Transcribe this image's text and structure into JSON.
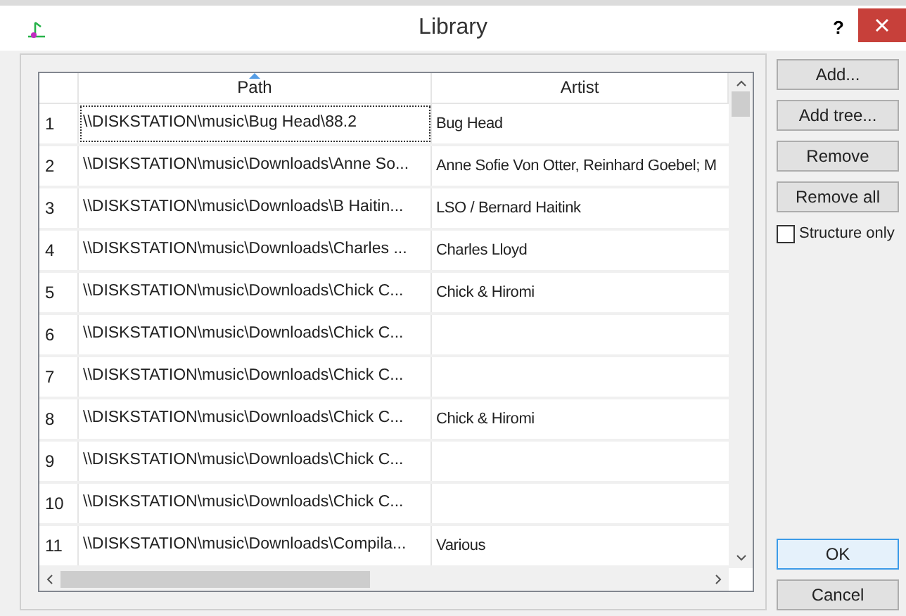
{
  "window": {
    "title": "Library",
    "help": "?"
  },
  "table": {
    "columns": [
      {
        "label": "Path",
        "sorted": true
      },
      {
        "label": "Artist",
        "sorted": false
      }
    ],
    "rows": [
      {
        "number": "1",
        "path": "\\\\DISKSTATION\\music\\Bug Head\\88.2",
        "artist": "Bug Head",
        "selected": true
      },
      {
        "number": "2",
        "path": "\\\\DISKSTATION\\music\\Downloads\\Anne So...",
        "artist": "Anne Sofie Von Otter, Reinhard Goebel; M",
        "selected": false
      },
      {
        "number": "3",
        "path": "\\\\DISKSTATION\\music\\Downloads\\B Haitin...",
        "artist": "LSO / Bernard Haitink",
        "selected": false
      },
      {
        "number": "4",
        "path": "\\\\DISKSTATION\\music\\Downloads\\Charles ...",
        "artist": "Charles Lloyd",
        "selected": false
      },
      {
        "number": "5",
        "path": "\\\\DISKSTATION\\music\\Downloads\\Chick C...",
        "artist": "Chick & Hiromi",
        "selected": false
      },
      {
        "number": "6",
        "path": "\\\\DISKSTATION\\music\\Downloads\\Chick C...",
        "selected": false
      },
      {
        "number": "7",
        "path": "\\\\DISKSTATION\\music\\Downloads\\Chick C...",
        "selected": false
      },
      {
        "number": "8",
        "path": "\\\\DISKSTATION\\music\\Downloads\\Chick C...",
        "artist": "Chick & Hiromi",
        "selected": false
      },
      {
        "number": "9",
        "path": "\\\\DISKSTATION\\music\\Downloads\\Chick C...",
        "selected": false
      },
      {
        "number": "10",
        "path": "\\\\DISKSTATION\\music\\Downloads\\Chick C...",
        "selected": false
      },
      {
        "number": "11",
        "path": "\\\\DISKSTATION\\music\\Downloads\\Compila...",
        "artist": "Various",
        "selected": false
      }
    ]
  },
  "side_buttons": [
    {
      "label": "Add..."
    },
    {
      "label": "Add tree..."
    },
    {
      "label": "Remove"
    },
    {
      "label": "Remove all"
    }
  ],
  "structure_only": {
    "label": "Structure only",
    "checked": false
  },
  "dialog_buttons": [
    {
      "label": "OK",
      "default": true
    },
    {
      "label": "Cancel",
      "default": false
    }
  ]
}
